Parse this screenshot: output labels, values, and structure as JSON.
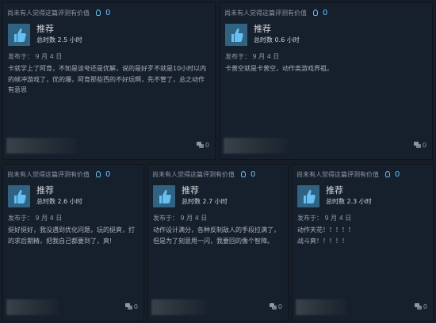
{
  "reviews": [
    {
      "helpful_text": "尚未有人觉得这篇评测有价值",
      "helpful_count": "0",
      "vote": "推荐",
      "hours": "总时数 2.5 小时",
      "posted": "发布于：  9 月 4 日",
      "text": "卡就学上了阿育，不知是该夸还是优解，说的是好歹不就是10小时以内\n的帧冲游戏了，优的爆，阿育那些西的不好玩啊，先不管了，总之动作\n有意思",
      "comments": "0"
    },
    {
      "helpful_text": "尚未有人觉得这篇评测有价值",
      "helpful_count": "0",
      "vote": "推荐",
      "hours": "总时数 0.6 小时",
      "posted": "发布于：  9 月 4 日",
      "text": "卡普空就是卡普空，动作类游戏界祖。",
      "comments": "0"
    },
    {
      "helpful_text": "尚未有人觉得这篇评测有价值",
      "helpful_count": "0",
      "vote": "推荐",
      "hours": "总时数 2.6 小时",
      "posted": "发布于：  9 月 4 日",
      "text": "挺好挺好，我没遇到优化问题，玩的挺爽，打\n的求后期精，把我自己都要到了，爽!",
      "comments": "0"
    },
    {
      "helpful_text": "尚未有人觉得这篇评测有价值",
      "helpful_count": "0",
      "vote": "推荐",
      "hours": "总时数 2.7 小时",
      "posted": "发布于：  9 月 4 日",
      "text": "动作设计满分，各种反制敌人的手段拉满了，\n但是为了刻意用一闪，我要回的像个智障。",
      "comments": "0"
    },
    {
      "helpful_text": "尚未有人觉得这篇评测有价值",
      "helpful_count": "0",
      "vote": "推荐",
      "hours": "总时数 2.3 小时",
      "posted": "发布于：  9 月 4 日",
      "text": "动作天花！！！！！\n战斗爽！！！！！",
      "comments": "0"
    }
  ]
}
